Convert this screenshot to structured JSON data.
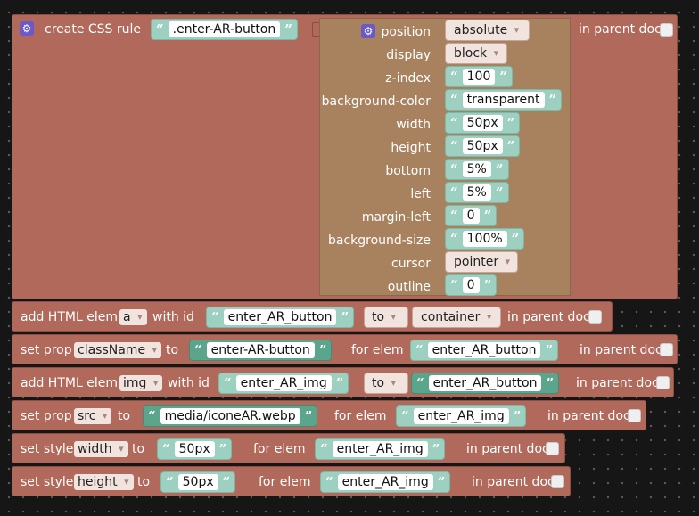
{
  "css_rule": {
    "label": "create CSS rule",
    "selector": ".enter-AR-button",
    "in_parent_doc": "in parent doc",
    "position": {
      "label": "position",
      "value": "absolute"
    },
    "display": {
      "label": "display",
      "value": "block"
    },
    "props": [
      {
        "label": "z-index",
        "value": "100"
      },
      {
        "label": "background-color",
        "value": "transparent"
      },
      {
        "label": "width",
        "value": "50px"
      },
      {
        "label": "height",
        "value": "50px"
      },
      {
        "label": "bottom",
        "value": "5%"
      },
      {
        "label": "left",
        "value": "5%"
      },
      {
        "label": "margin-left",
        "value": "0"
      },
      {
        "label": "background-size",
        "value": "100%"
      }
    ],
    "cursor": {
      "label": "cursor",
      "value": "pointer"
    },
    "outline": {
      "label": "outline",
      "value": "0"
    }
  },
  "b1": {
    "label": "add HTML elem",
    "tag": "a",
    "with_id": "with id",
    "id": "enter_AR_button",
    "to": "to",
    "parent": "container",
    "in_parent_doc": "in parent doc"
  },
  "b2": {
    "label": "set prop",
    "prop": "className",
    "to": "to",
    "value": "enter-AR-button",
    "for_elem": "for elem",
    "elem": "enter_AR_button",
    "in_parent_doc": "in parent doc"
  },
  "b3": {
    "label": "add HTML elem",
    "tag": "img",
    "with_id": "with id",
    "id": "enter_AR_img",
    "to": "to",
    "parent": "enter_AR_button",
    "in_parent_doc": "in parent doc"
  },
  "b4": {
    "label": "set prop",
    "prop": "src",
    "to": "to",
    "value": "media/iconeAR.webp",
    "for_elem": "for elem",
    "elem": "enter_AR_img",
    "in_parent_doc": "in parent doc"
  },
  "b5": {
    "label": "set style",
    "prop": "width",
    "to": "to",
    "value": "50px",
    "for_elem": "for elem",
    "elem": "enter_AR_img",
    "in_parent_doc": "in parent doc"
  },
  "b6": {
    "label": "set style",
    "prop": "height",
    "to": "to",
    "value": "50px",
    "for_elem": "for elem",
    "elem": "enter_AR_img",
    "in_parent_doc": "in parent doc"
  },
  "icons": {
    "gear": "gear-icon",
    "quote": "quote-icon",
    "dropdown": "chevron-down-icon"
  },
  "colors": {
    "block": "#b0695a",
    "css_props": "#a8825e",
    "text": "#9ed0c1",
    "text_dark": "#5ba58c",
    "gear": "#6b58c9",
    "workspace": "#161616"
  }
}
